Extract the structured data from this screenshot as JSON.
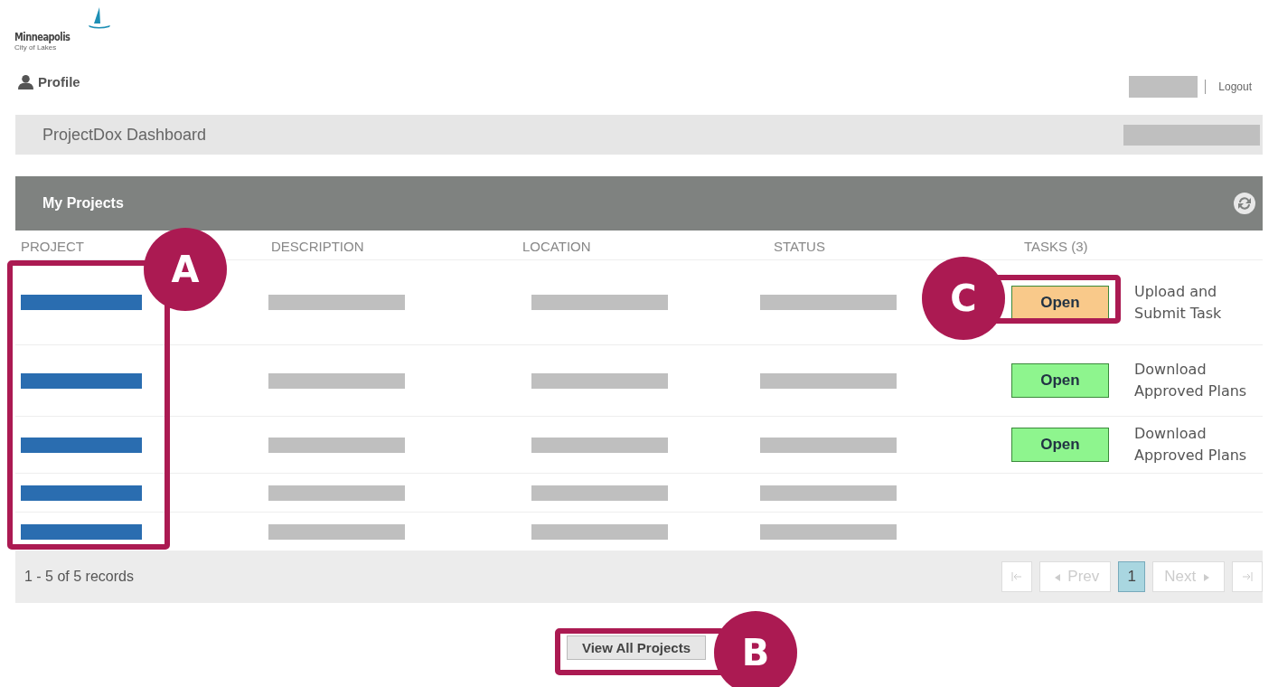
{
  "logo": {
    "name": "Minneapolis",
    "tagline": "City of Lakes"
  },
  "profile_link": "Profile",
  "logout_link": "Logout",
  "dashboard_title": "ProjectDox Dashboard",
  "panel": {
    "title": "My Projects",
    "columns": [
      "PROJECT",
      "DESCRIPTION",
      "LOCATION",
      "STATUS",
      "TASKS (3)"
    ],
    "rows": [
      {
        "task": {
          "button": "Open",
          "color": "#f9c98a",
          "text": "Upload and Submit Task"
        }
      },
      {
        "task": {
          "button": "Open",
          "color": "#8ef58e",
          "text": "Download Approved Plans"
        }
      },
      {
        "task": {
          "button": "Open",
          "color": "#8ef58e",
          "text": "Download Approved Plans"
        }
      },
      {},
      {}
    ],
    "summary": "1 - 5 of 5 records",
    "pager": {
      "prev": "Prev",
      "next": "Next",
      "prev_disabled": true,
      "next_disabled": true,
      "pages": [
        {
          "label": "1",
          "selected": true
        }
      ]
    }
  },
  "view_all_button": "View All Projects",
  "callouts": [
    {
      "label": "A"
    },
    {
      "label": "B"
    },
    {
      "label": "C"
    }
  ]
}
